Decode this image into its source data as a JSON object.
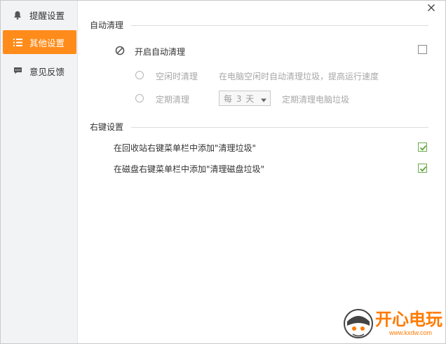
{
  "sidebar": {
    "items": [
      {
        "label": "提醒设置",
        "icon": "bell-icon",
        "active": false
      },
      {
        "label": "其他设置",
        "icon": "list-icon",
        "active": true
      },
      {
        "label": "意见反馈",
        "icon": "chat-bubble-icon",
        "active": false
      }
    ]
  },
  "auto_clean": {
    "section_title": "自动清理",
    "enable_label": "开启自动清理",
    "enable_checked": false,
    "idle_option": {
      "label": "空闲时清理",
      "description": "在电脑空闲时自动清理垃圾，提高运行速度",
      "selected": false
    },
    "scheduled_option": {
      "label": "定期清理",
      "frequency_value": "每 3 天",
      "description": "定期清理电脑垃圾",
      "selected": false
    }
  },
  "context_menu": {
    "section_title": "右键设置",
    "recycle_bin": {
      "label": "在回收站右键菜单栏中添加\"清理垃圾\"",
      "checked": true
    },
    "disk": {
      "label": "在磁盘右键菜单栏中添加\"清理磁盘垃圾\"",
      "checked": true
    }
  },
  "watermark": {
    "brand": "开心电玩",
    "url": "www.kxdw.com"
  },
  "colors": {
    "accent": "#ff8c1a",
    "check_green": "#5fa33a",
    "watermark": "#ff7a00"
  }
}
